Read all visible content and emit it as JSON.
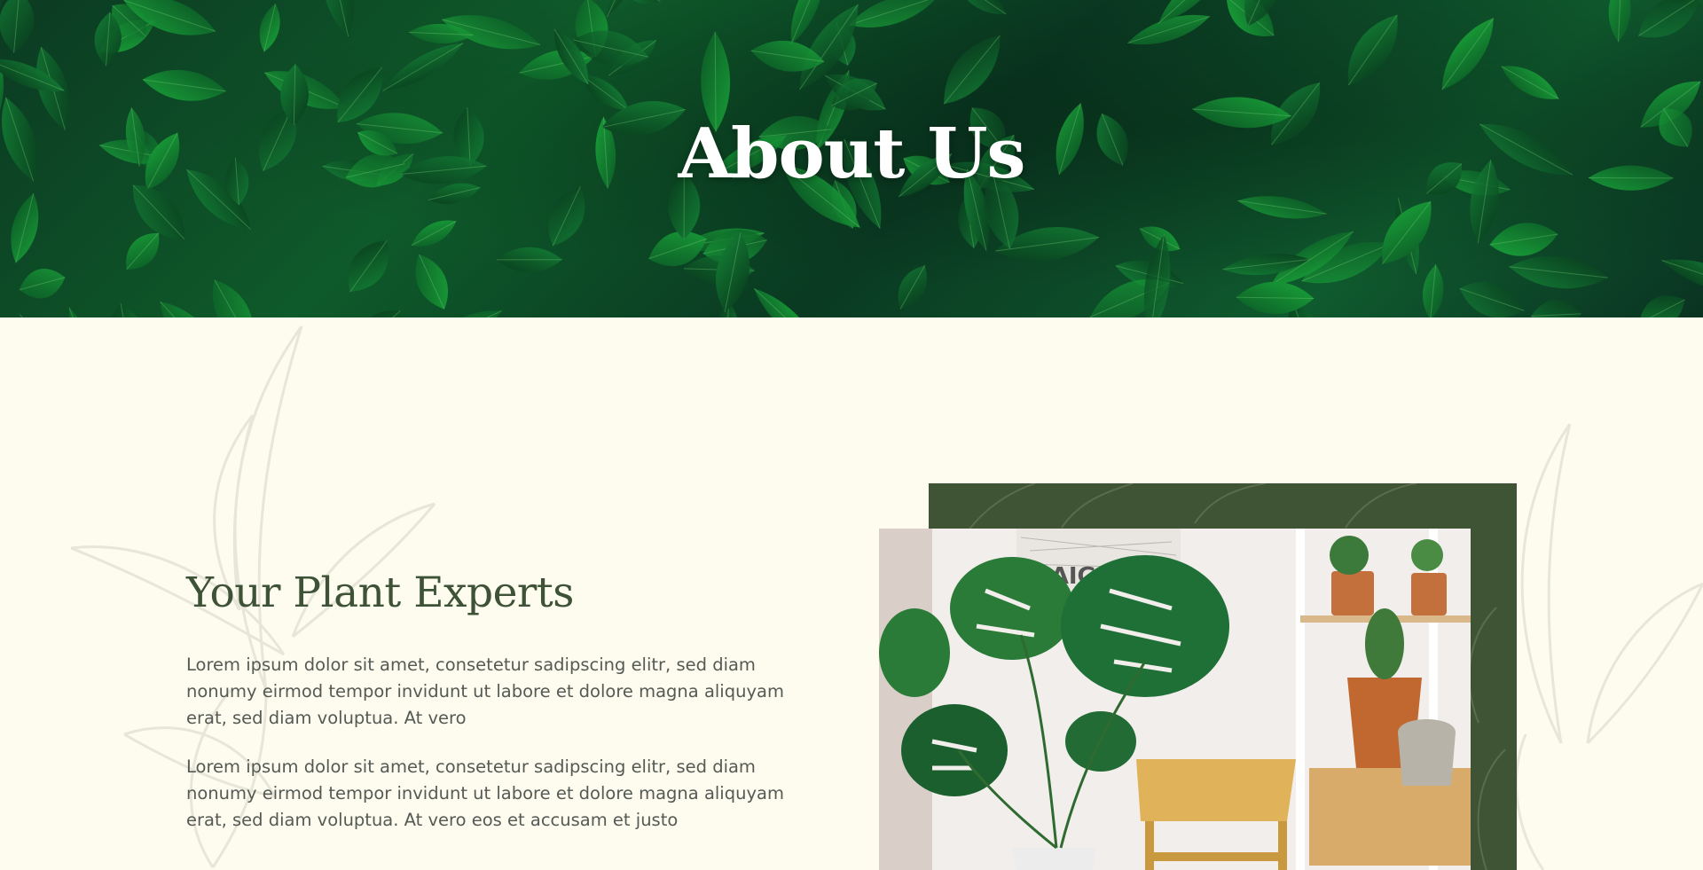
{
  "hero": {
    "title": "About Us"
  },
  "about": {
    "heading": "Your Plant Experts",
    "paragraphs": [
      "Lorem ipsum dolor sit amet, consetetur sadipscing elitr, sed diam nonumy eirmod tempor invidunt ut labore et dolore magna aliquyam erat, sed diam voluptua. At vero",
      "Lorem ipsum dolor sit amet, consetetur sadipscing elitr, sed diam nonumy eirmod tempor invidunt ut labore et dolore magna aliquyam erat, sed diam voluptua. At vero eos et accusam et justo"
    ],
    "photo_poster_text": "SAIGON"
  },
  "colors": {
    "background": "#fefcee",
    "heading": "#3d5236",
    "body_text": "#555a55",
    "frame": "#3f5335",
    "hero_title": "#ffffff"
  }
}
